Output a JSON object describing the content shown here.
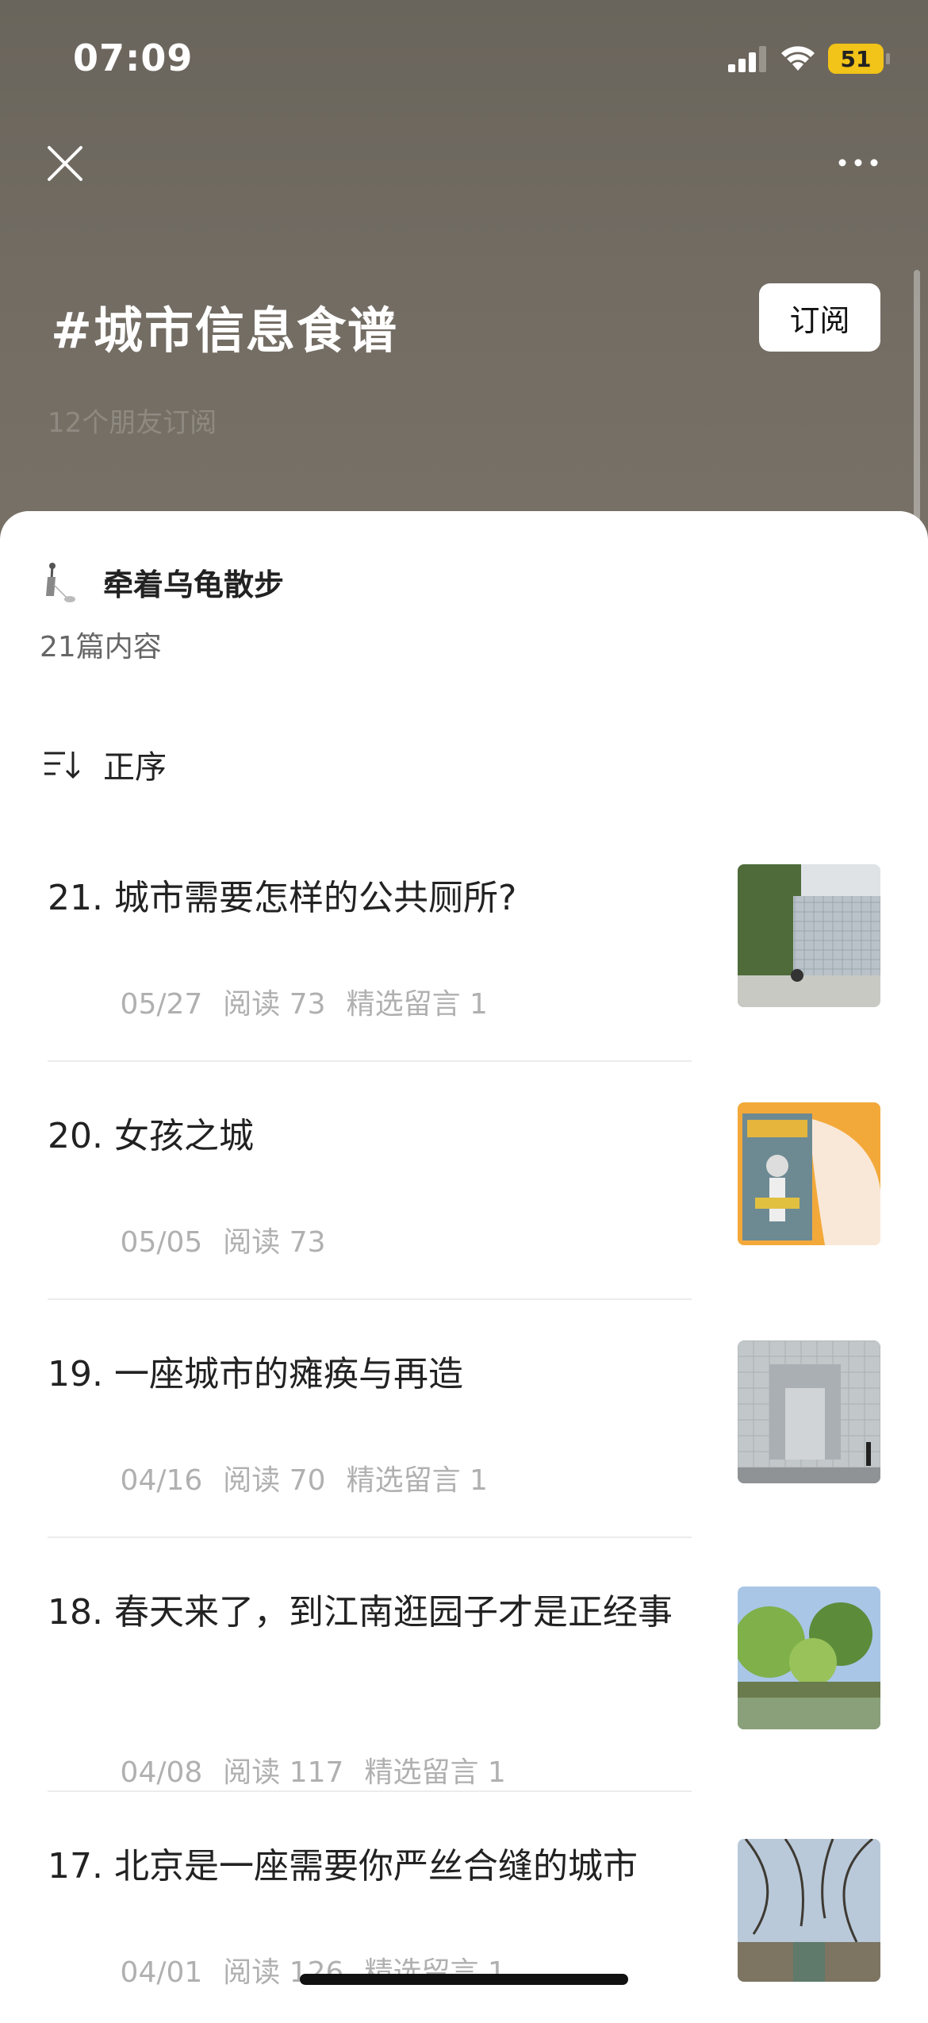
{
  "status_bar": {
    "time": "07:09",
    "battery": "51"
  },
  "topic": {
    "title": "#城市信息食谱",
    "subscribe_label": "订阅",
    "subscriber_count": "12个朋友订阅"
  },
  "author": {
    "name": "牵着乌龟散步",
    "article_count": "21篇内容"
  },
  "sort": {
    "label": "正序"
  },
  "articles": [
    {
      "title": "21. 城市需要怎样的公共厕所?",
      "date": "05/27",
      "reads": "阅读 73",
      "comments": "精选留言 1"
    },
    {
      "title": "20. 女孩之城",
      "date": "05/05",
      "reads": "阅读 73",
      "comments": ""
    },
    {
      "title": "19. 一座城市的瘫痪与再造",
      "date": "04/16",
      "reads": "阅读 70",
      "comments": "精选留言 1"
    },
    {
      "title": "18. 春天来了，到江南逛园子才是正经事",
      "date": "04/08",
      "reads": "阅读 117",
      "comments": "精选留言 1"
    },
    {
      "title": "17. 北京是一座需要你严丝合缝的城市",
      "date": "04/01",
      "reads": "阅读 126",
      "comments": "精选留言 1"
    }
  ],
  "colors": {
    "header_bg": "#6e685f",
    "accent_white": "#ffffff",
    "battery": "#f2c318"
  }
}
